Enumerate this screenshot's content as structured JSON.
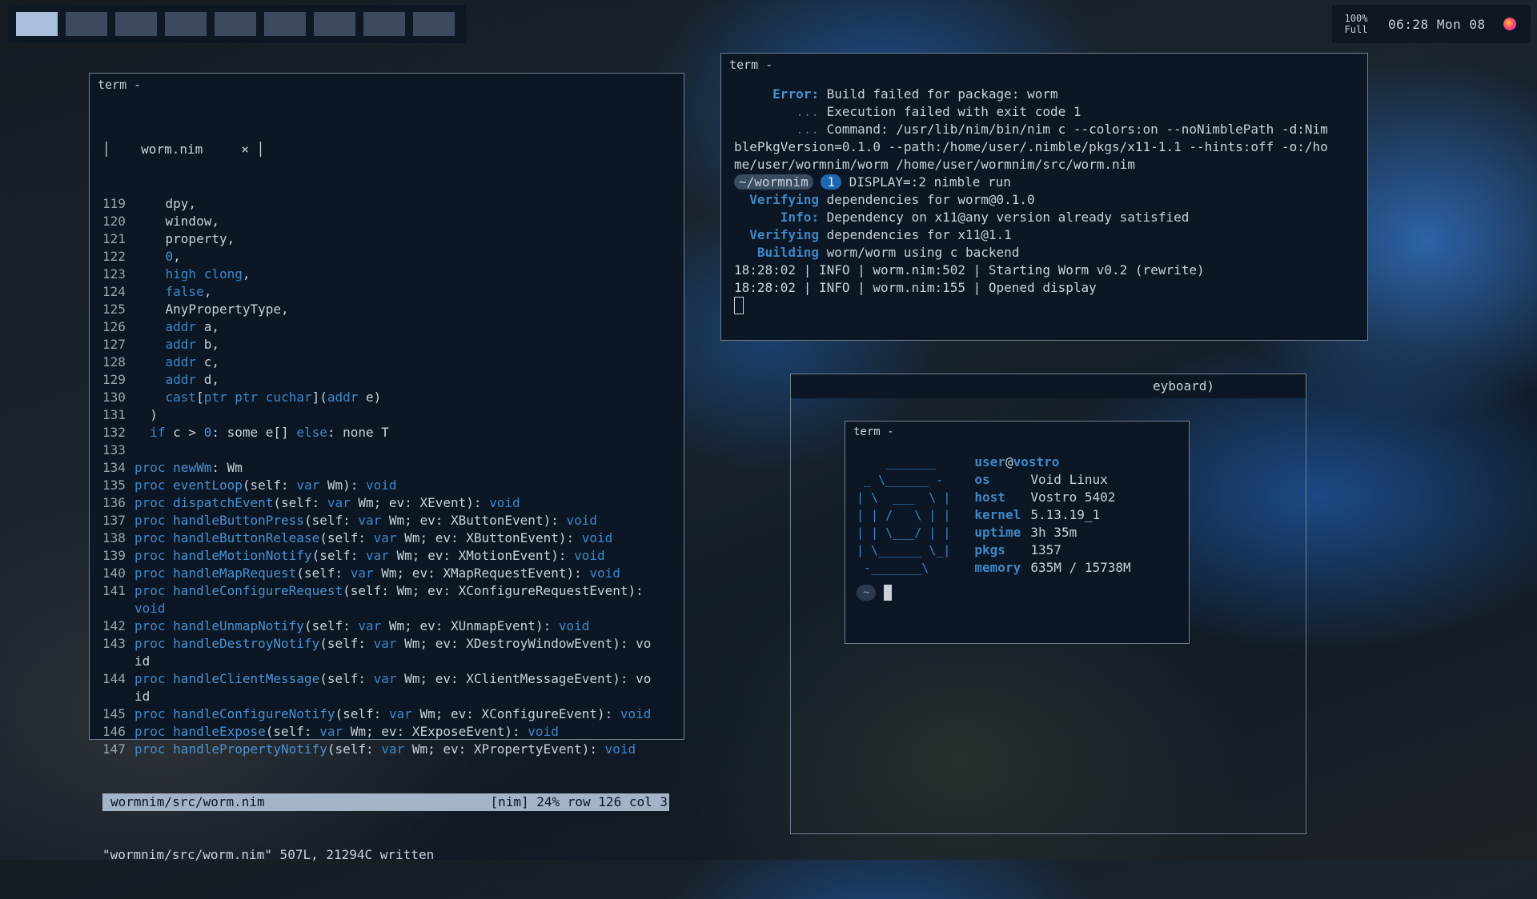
{
  "workspaces": [
    {
      "id": "1",
      "active": true
    },
    {
      "id": "2"
    },
    {
      "id": "3"
    },
    {
      "id": "4"
    },
    {
      "id": "5"
    },
    {
      "id": "6"
    },
    {
      "id": "7"
    },
    {
      "id": "8"
    },
    {
      "id": "9"
    }
  ],
  "status": {
    "battery_pct": "100%",
    "battery_state": "Full",
    "time": "06:28",
    "day": "Mon 08"
  },
  "editor": {
    "title": "term -",
    "tab_name": "worm.nim",
    "tab_close": "×",
    "lines": [
      {
        "n": "119",
        "t": "    dpy,"
      },
      {
        "n": "120",
        "t": "    window,"
      },
      {
        "n": "121",
        "t": "    property,"
      },
      {
        "n": "122",
        "t": "    0,"
      },
      {
        "n": "123",
        "t": "    high clong,"
      },
      {
        "n": "124",
        "t": "    false,"
      },
      {
        "n": "125",
        "t": "    AnyPropertyType,"
      },
      {
        "n": "126",
        "t": "    addr a,"
      },
      {
        "n": "127",
        "t": "    addr b,"
      },
      {
        "n": "128",
        "t": "    addr c,"
      },
      {
        "n": "129",
        "t": "    addr d,"
      },
      {
        "n": "130",
        "t": "    cast[ptr ptr cuchar](addr e)"
      },
      {
        "n": "131",
        "t": "  )"
      },
      {
        "n": "132",
        "t": "  if c > 0: some e[] else: none T"
      },
      {
        "n": "133",
        "t": ""
      },
      {
        "n": "134",
        "t": "proc newWm: Wm"
      },
      {
        "n": "135",
        "t": "proc eventLoop(self: var Wm): void"
      },
      {
        "n": "136",
        "t": "proc dispatchEvent(self: var Wm; ev: XEvent): void"
      },
      {
        "n": "137",
        "t": "proc handleButtonPress(self: var Wm; ev: XButtonEvent): void"
      },
      {
        "n": "138",
        "t": "proc handleButtonRelease(self: var Wm; ev: XButtonEvent): void"
      },
      {
        "n": "139",
        "t": "proc handleMotionNotify(self: var Wm; ev: XMotionEvent): void"
      },
      {
        "n": "140",
        "t": "proc handleMapRequest(self: var Wm; ev: XMapRequestEvent): void"
      },
      {
        "n": "141",
        "t": "proc handleConfigureRequest(self: Wm; ev: XConfigureRequestEvent):"
      },
      {
        "n": "",
        "t": "void"
      },
      {
        "n": "142",
        "t": "proc handleUnmapNotify(self: var Wm; ev: XUnmapEvent): void"
      },
      {
        "n": "143",
        "t": "proc handleDestroyNotify(self: var Wm; ev: XDestroyWindowEvent): vo"
      },
      {
        "n": "",
        "t": "id"
      },
      {
        "n": "144",
        "t": "proc handleClientMessage(self: var Wm; ev: XClientMessageEvent): vo"
      },
      {
        "n": "",
        "t": "id"
      },
      {
        "n": "145",
        "t": "proc handleConfigureNotify(self: var Wm; ev: XConfigureEvent): void"
      },
      {
        "n": "146",
        "t": "proc handleExpose(self: var Wm; ev: XExposeEvent): void"
      },
      {
        "n": "147",
        "t": "proc handlePropertyNotify(self: var Wm; ev: XPropertyEvent): void"
      }
    ],
    "statusline_left": "wormnim/src/worm.nim",
    "statusline_right": "[nim] 24% row 126 col 3",
    "message": "\"wormnim/src/worm.nim\" 507L, 21294C written"
  },
  "build_term": {
    "title": "term -",
    "lines": [
      "     Error: Build failed for package: worm",
      "        ... Execution failed with exit code 1",
      "        ... Command: /usr/lib/nim/bin/nim c --colors:on --noNimblePath -d:Nim",
      "blePkgVersion=0.1.0 --path:/home/user/.nimble/pkgs/x11-1.1 --hints:off -o:/ho",
      "me/user/wormnim/worm /home/user/wormnim/src/worm.nim"
    ],
    "prompt_dir": "~/wormnim",
    "prompt_badge": "1",
    "prompt_cmd": " DISPLAY=:2 nimble run",
    "after": [
      {
        "label": "  Verifying",
        "text": " dependencies for worm@0.1.0"
      },
      {
        "label": "      Info:",
        "text": " Dependency on x11@any version already satisfied"
      },
      {
        "label": "  Verifying",
        "text": " dependencies for x11@1.1"
      },
      {
        "label": "   Building",
        "text": " worm/worm using c backend"
      }
    ],
    "log": [
      "18:28:02 | INFO | worm.nim:502 | Starting Worm v0.2 (rewrite)",
      "18:28:02 | INFO | worm.nim:155 | Opened display"
    ]
  },
  "outer_frame": {
    "title": "eyboard)"
  },
  "neofetch": {
    "title": "term -",
    "ascii": "    _______\n _ \\______ -\n| \\  ___  \\ |\n| | /   \\ | |\n| | \\___/ | |\n| \\______ \\_|\n -_______\\",
    "user": "user",
    "at": "@",
    "host_name": "vostro",
    "fields": [
      {
        "k": "os",
        "v": "Void Linux"
      },
      {
        "k": "host",
        "v": "Vostro 5402"
      },
      {
        "k": "kernel",
        "v": "5.13.19_1"
      },
      {
        "k": "uptime",
        "v": "3h 35m"
      },
      {
        "k": "pkgs",
        "v": "1357"
      },
      {
        "k": "memory",
        "v": "635M / 15738M"
      }
    ],
    "prompt": "~"
  }
}
